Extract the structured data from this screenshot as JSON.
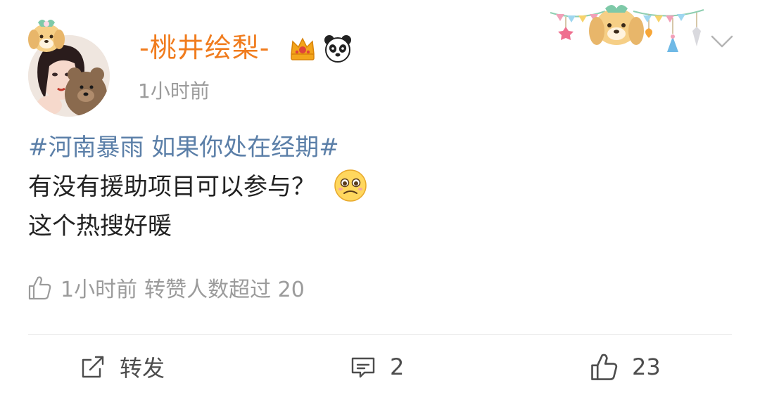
{
  "post": {
    "username": "-桃井绘梨-",
    "time": "1小时前",
    "content": {
      "hashtag": "#河南暴雨 如果你处在经期#",
      "line2": "有没有援助项目可以参与？",
      "line3": "这个热搜好暖"
    },
    "meta": {
      "time": "1小时前",
      "repost_info": "转赞人数超过 20"
    }
  },
  "actions": {
    "repost_label": "转发",
    "comment_count": "2",
    "like_count": "23"
  },
  "icons": {
    "badges": [
      "crown-badge-icon",
      "panda-icon"
    ],
    "inline_emoji": "pleading-face-emoji",
    "more": "chevron-down-icon"
  },
  "colors": {
    "username": "#f07c1e",
    "hashtag": "#5b7fa8",
    "muted": "#9b9b9b"
  }
}
